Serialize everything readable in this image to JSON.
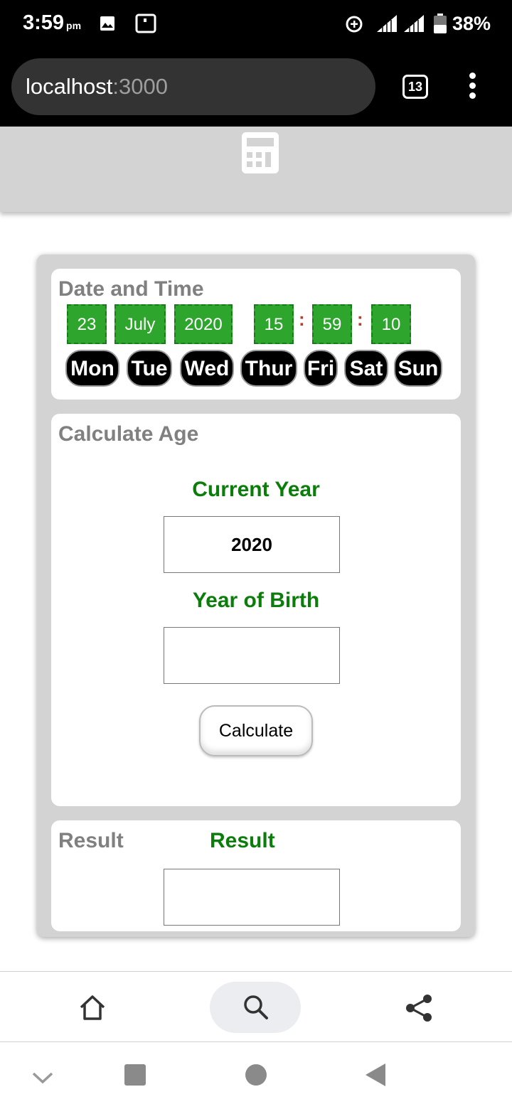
{
  "status_bar": {
    "time": "3:59",
    "ampm": "pm",
    "battery": "38%",
    "icons": [
      "image-icon",
      "screen-icon",
      "data-saver-icon",
      "signal-icon",
      "signal-icon",
      "battery-icon"
    ]
  },
  "browser": {
    "url_host": "localhost",
    "url_port": ":3000",
    "tab_count": "13"
  },
  "app": {
    "header_icon": "calculator-icon",
    "date_time": {
      "title": "Date and Time",
      "day": "23",
      "month": "July",
      "year": "2020",
      "hour": "15",
      "minute": "59",
      "second": "10",
      "separator": ":",
      "weekdays": [
        "Mon",
        "Tue",
        "Wed",
        "Thur",
        "Fri",
        "Sat",
        "Sun"
      ]
    },
    "calculate_age": {
      "title": "Calculate Age",
      "current_year_label": "Current Year",
      "current_year_value": "2020",
      "birth_year_label": "Year of Birth",
      "birth_year_value": "",
      "button_label": "Calculate"
    },
    "result": {
      "title": "Result",
      "label": "Result",
      "value": ""
    }
  },
  "colors": {
    "green_box": "#2ea62e",
    "green_text": "#0a7d0a",
    "panel_gray": "#d3d3d3",
    "title_gray": "#808080"
  }
}
